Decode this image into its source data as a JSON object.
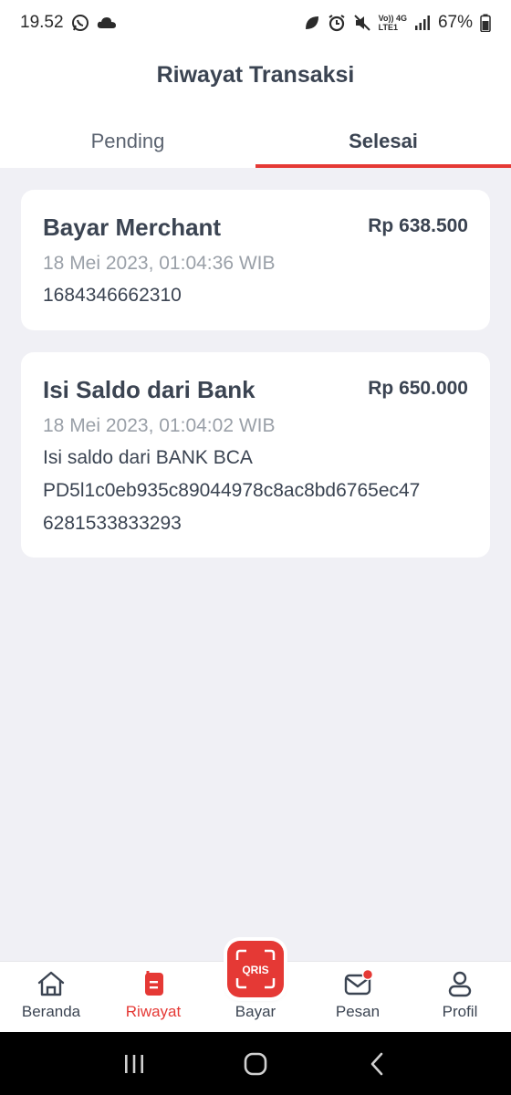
{
  "status_bar": {
    "time": "19.52",
    "network_label": "Vo)) 4G",
    "lte_label": "LTE1",
    "battery": "67%"
  },
  "header": {
    "title": "Riwayat Transaksi",
    "tabs": [
      {
        "label": "Pending",
        "active": false
      },
      {
        "label": "Selesai",
        "active": true
      }
    ]
  },
  "transactions": [
    {
      "title": "Bayar Merchant",
      "amount": "Rp 638.500",
      "date": "18 Mei 2023, 01:04:36 WIB",
      "lines": [
        "1684346662310"
      ]
    },
    {
      "title": "Isi Saldo dari Bank",
      "amount": "Rp 650.000",
      "date": "18 Mei 2023, 01:04:02 WIB",
      "lines": [
        "Isi saldo dari BANK BCA",
        "PD5l1c0eb935c89044978c8ac8bd6765ec47",
        "6281533833293"
      ]
    }
  ],
  "bottom_nav": {
    "items": [
      {
        "label": "Beranda",
        "icon": "home-icon"
      },
      {
        "label": "Riwayat",
        "icon": "history-icon",
        "active": true
      },
      {
        "label": "Bayar",
        "icon": "qris-icon"
      },
      {
        "label": "Pesan",
        "icon": "mail-icon",
        "badge": true
      },
      {
        "label": "Profil",
        "icon": "profile-icon"
      }
    ],
    "qris_text": "QRIS"
  },
  "colors": {
    "accent": "#e53935",
    "text": "#3b4452",
    "muted": "#9aa0a8",
    "background": "#f0f0f5"
  }
}
